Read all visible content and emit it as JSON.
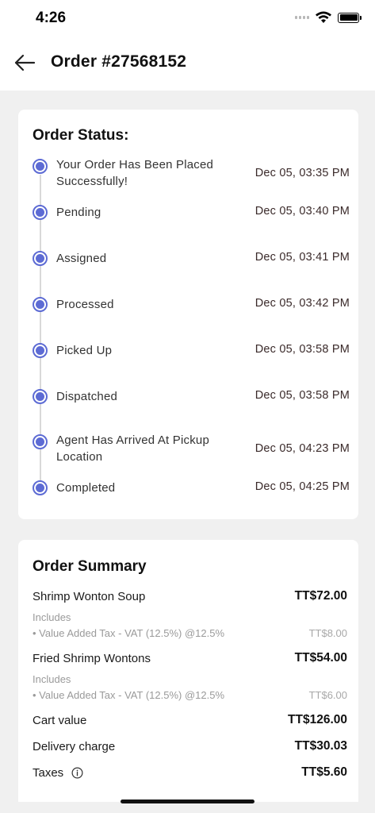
{
  "status_bar": {
    "time": "4:26"
  },
  "header": {
    "title": "Order #27568152"
  },
  "order_status": {
    "title": "Order Status:",
    "steps": [
      {
        "label": "Your Order Has Been Placed Successfully!",
        "time": "Dec 05, 03:35 PM"
      },
      {
        "label": "Pending",
        "time": "Dec 05, 03:40 PM"
      },
      {
        "label": "Assigned",
        "time": "Dec 05, 03:41 PM"
      },
      {
        "label": "Processed",
        "time": "Dec 05, 03:42 PM"
      },
      {
        "label": "Picked Up",
        "time": "Dec 05, 03:58 PM"
      },
      {
        "label": "Dispatched",
        "time": "Dec 05, 03:58 PM"
      },
      {
        "label": "Agent Has Arrived At Pickup Location",
        "time": "Dec 05, 04:23 PM"
      },
      {
        "label": "Completed",
        "time": "Dec 05, 04:25 PM"
      }
    ]
  },
  "order_summary": {
    "title": "Order Summary",
    "items": [
      {
        "name": "Shrimp Wonton Soup",
        "price": "TT$72.00",
        "includes_label": "Includes",
        "tax_label": "• Value Added Tax - VAT (12.5%) @12.5%",
        "tax_amount": "TT$8.00"
      },
      {
        "name": "Fried Shrimp Wontons",
        "price": "TT$54.00",
        "includes_label": "Includes",
        "tax_label": "• Value Added Tax - VAT (12.5%) @12.5%",
        "tax_amount": "TT$6.00"
      }
    ],
    "cart_value_label": "Cart value",
    "cart_value": "TT$126.00",
    "delivery_label": "Delivery charge",
    "delivery_value": "TT$30.03",
    "taxes_label": "Taxes",
    "taxes_value": "TT$5.60"
  },
  "colors": {
    "accent": "#5d6bd4",
    "background": "#f0f0f0",
    "card": "#ffffff"
  }
}
